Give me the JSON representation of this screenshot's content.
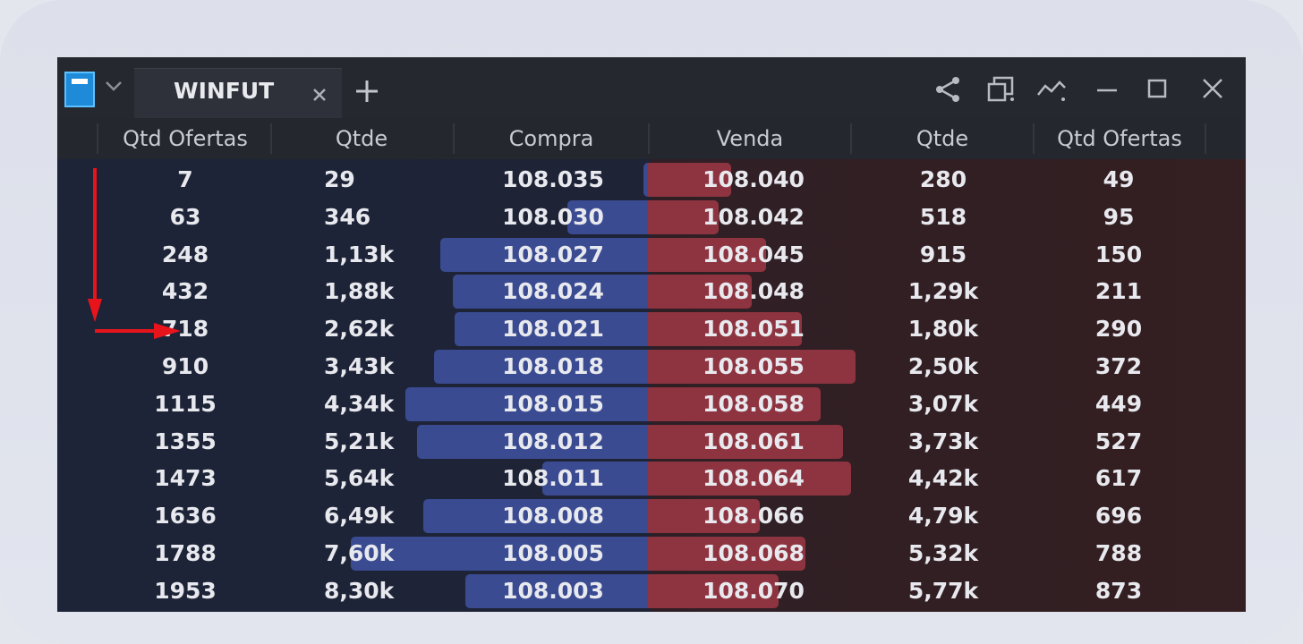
{
  "window": {
    "tab_label": "WINFUT",
    "logo_icon": "app-logo-icon",
    "icons": [
      "chevron-down-icon",
      "close-icon",
      "plus-icon",
      "share-icon",
      "detach-window-icon",
      "chart-icon",
      "minimize-icon",
      "maximize-icon",
      "close-window-icon"
    ]
  },
  "columns": {
    "buy_offers": "Qtd Ofertas",
    "buy_qty": "Qtde",
    "buy_price": "Compra",
    "sell_price": "Venda",
    "sell_qty": "Qtde",
    "sell_offers": "Qtd Ofertas"
  },
  "colors": {
    "buy_bar": "#3a4b92",
    "sell_bar": "#8e3440",
    "annotation_arrow": "#e8141c"
  },
  "rows": [
    {
      "buy_offers": "7",
      "buy_qty": "29",
      "buy_price": "108.035",
      "sell_price": "108.040",
      "sell_qty": "280",
      "sell_offers": "49",
      "buy_depth": 0.02,
      "sell_depth": 0.4
    },
    {
      "buy_offers": "63",
      "buy_qty": "346",
      "buy_price": "108.030",
      "sell_price": "108.042",
      "sell_qty": "518",
      "sell_offers": "95",
      "buy_depth": 0.39,
      "sell_depth": 0.34
    },
    {
      "buy_offers": "248",
      "buy_qty": "1,13k",
      "buy_price": "108.027",
      "sell_price": "108.045",
      "sell_qty": "915",
      "sell_offers": "150",
      "buy_depth": 1.0,
      "sell_depth": 0.57
    },
    {
      "buy_offers": "432",
      "buy_qty": "1,88k",
      "buy_price": "108.024",
      "sell_price": "108.048",
      "sell_qty": "1,29k",
      "sell_offers": "211",
      "buy_depth": 0.94,
      "sell_depth": 0.5
    },
    {
      "buy_offers": "718",
      "buy_qty": "2,62k",
      "buy_price": "108.021",
      "sell_price": "108.051",
      "sell_qty": "1,80k",
      "sell_offers": "290",
      "buy_depth": 0.93,
      "sell_depth": 0.74
    },
    {
      "buy_offers": "910",
      "buy_qty": "3,43k",
      "buy_price": "108.018",
      "sell_price": "108.055",
      "sell_qty": "2,50k",
      "sell_offers": "372",
      "buy_depth": 1.03,
      "sell_depth": 1.0
    },
    {
      "buy_offers": "1115",
      "buy_qty": "4,34k",
      "buy_price": "108.015",
      "sell_price": "108.058",
      "sell_qty": "3,07k",
      "sell_offers": "449",
      "buy_depth": 1.17,
      "sell_depth": 0.83
    },
    {
      "buy_offers": "1355",
      "buy_qty": "5,21k",
      "buy_price": "108.012",
      "sell_price": "108.061",
      "sell_qty": "3,73k",
      "sell_offers": "527",
      "buy_depth": 1.11,
      "sell_depth": 0.94
    },
    {
      "buy_offers": "1473",
      "buy_qty": "5,64k",
      "buy_price": "108.011",
      "sell_price": "108.064",
      "sell_qty": "4,42k",
      "sell_offers": "617",
      "buy_depth": 0.51,
      "sell_depth": 0.98
    },
    {
      "buy_offers": "1636",
      "buy_qty": "6,49k",
      "buy_price": "108.008",
      "sell_price": "108.066",
      "sell_qty": "4,79k",
      "sell_offers": "696",
      "buy_depth": 1.08,
      "sell_depth": 0.54
    },
    {
      "buy_offers": "1788",
      "buy_qty": "7,60k",
      "buy_price": "108.005",
      "sell_price": "108.068",
      "sell_qty": "5,32k",
      "sell_offers": "788",
      "buy_depth": 1.43,
      "sell_depth": 0.76
    },
    {
      "buy_offers": "1953",
      "buy_qty": "8,30k",
      "buy_price": "108.003",
      "sell_price": "108.070",
      "sell_qty": "5,77k",
      "sell_offers": "873",
      "buy_depth": 0.88,
      "sell_depth": 0.63
    }
  ]
}
